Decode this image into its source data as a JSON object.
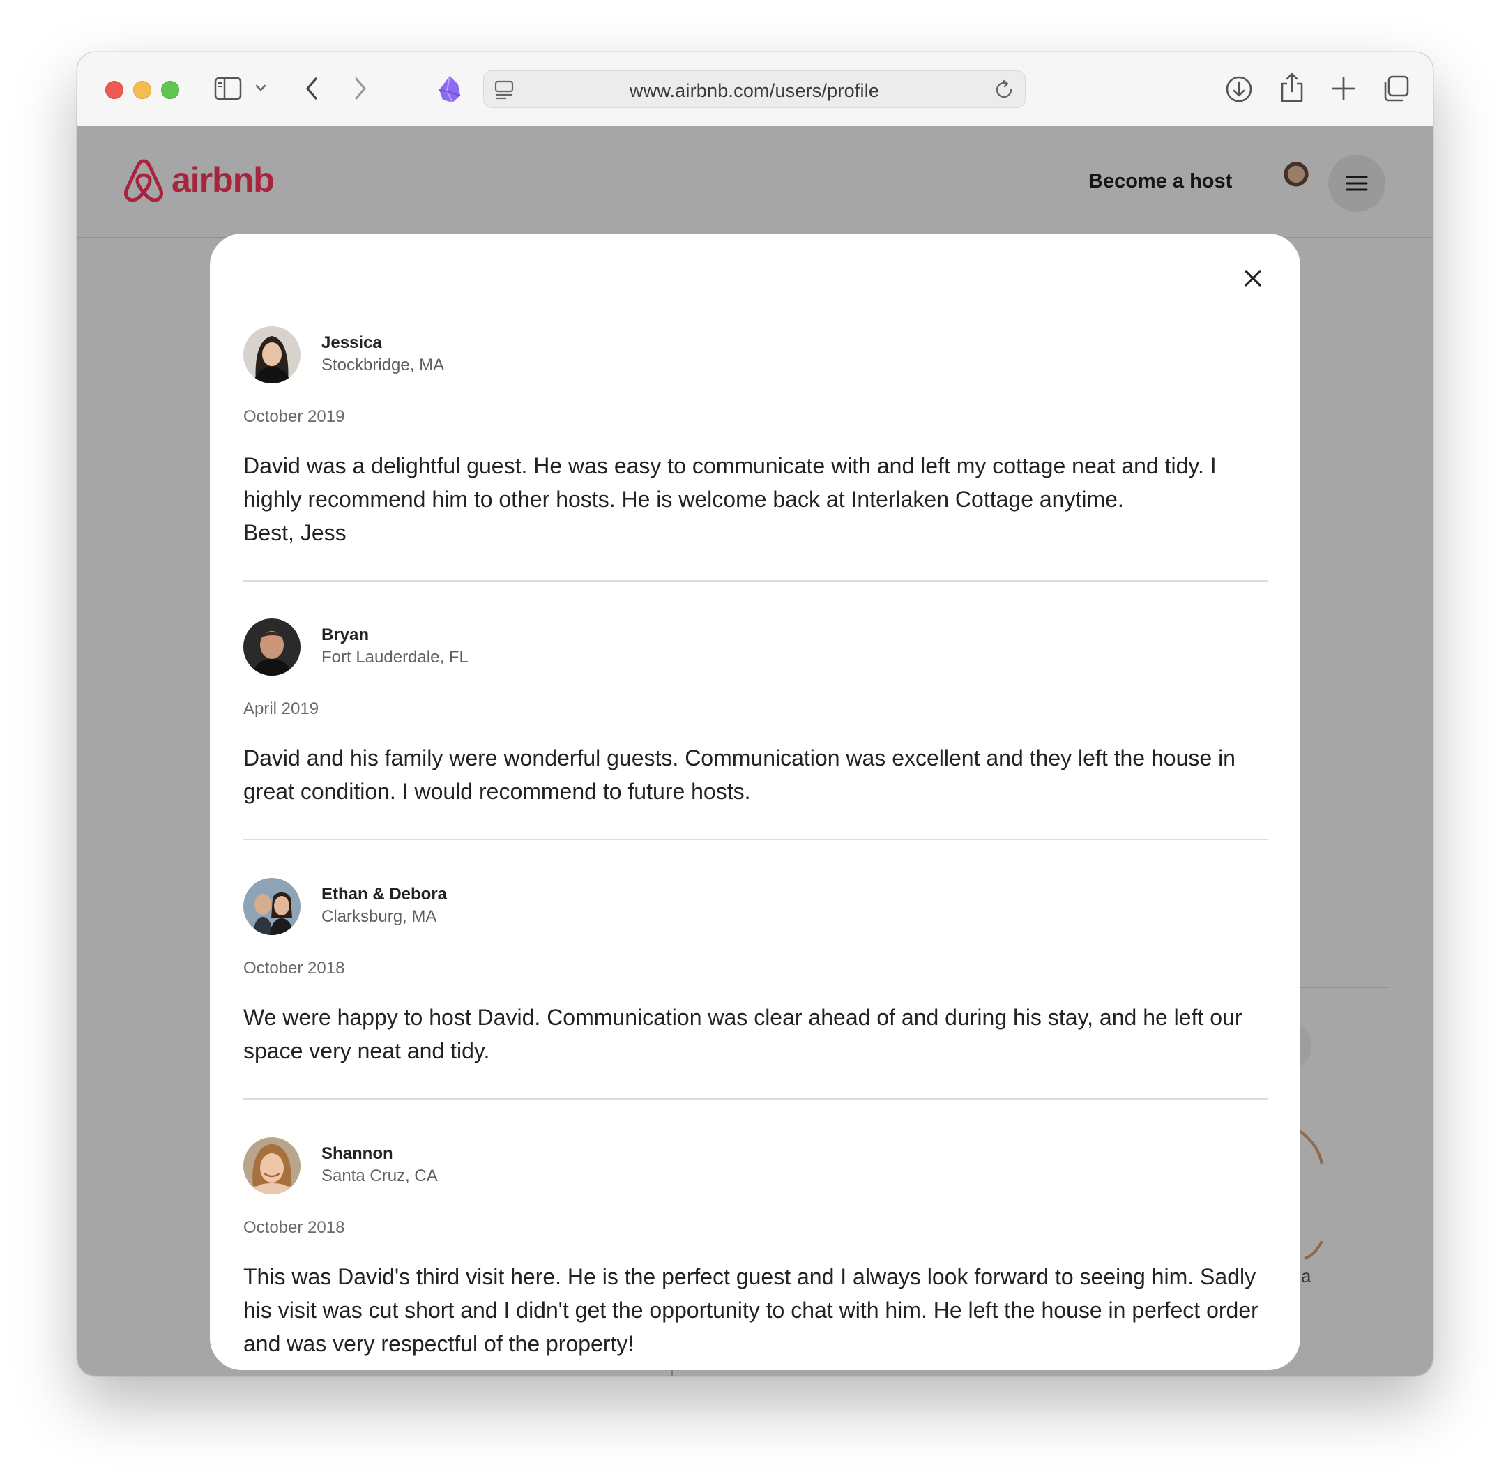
{
  "browser": {
    "url": "www.airbnb.com/users/profile"
  },
  "site": {
    "logo_text": "airbnb",
    "become_host": "Become a host",
    "brand_color": "#ff385c"
  },
  "modal": {
    "reviews": [
      {
        "name": "Jessica",
        "location": "Stockbridge, MA",
        "date": "October 2019",
        "text": "David was a delightful guest. He was easy to communicate with and left my cottage neat and tidy. I highly recommend him to other hosts. He is welcome back at Interlaken Cottage anytime.\nBest, Jess"
      },
      {
        "name": "Bryan",
        "location": "Fort Lauderdale, FL",
        "date": "April 2019",
        "text": "David and his family were wonderful guests. Communication was excellent and they left the house in great condition. I would recommend to future hosts."
      },
      {
        "name": "Ethan & Debora",
        "location": "Clarksburg, MA",
        "date": "October 2018",
        "text": "We were happy to host David. Communication was clear ahead of and during his stay, and he left our space very neat and tidy."
      },
      {
        "name": "Shannon",
        "location": "Santa Cruz, CA",
        "date": "October 2018",
        "text": "This was David's third visit here. He is the perfect guest and I always look forward to seeing him. Sadly his visit was cut short and I didn't get the opportunity to chat with him. He left the house in perfect order and was very respectful of the property!"
      }
    ]
  },
  "background": {
    "fragment_text": "a"
  }
}
